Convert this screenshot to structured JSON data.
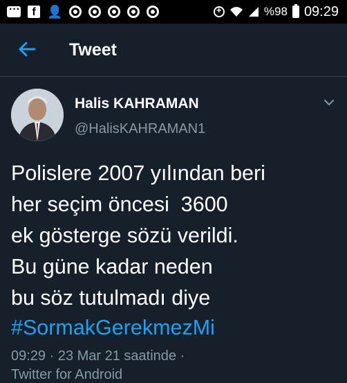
{
  "status_bar": {
    "battery_percent": "%98",
    "time": "09:29",
    "icons": [
      "message-icon",
      "facebook-icon",
      "add-user-icon",
      "chrome-icon",
      "chrome-icon",
      "chrome-icon",
      "chrome-icon",
      "chrome-icon",
      "sync-icon",
      "wifi-icon",
      "signal-icon",
      "battery-icon"
    ]
  },
  "app_bar": {
    "title": "Tweet",
    "back_icon": "arrow-left-icon"
  },
  "tweet": {
    "author_name": "Halis KAHRAMAN",
    "author_handle": "@HalisKAHRAMAN1",
    "text": "Polislere 2007 yılından beri\nher seçim öncesi  3600\nek gösterge sözü verildi.\nBu güne kadar neden\nbu söz tutulmadı diye",
    "hashtag": "#SormakGerekmezMi",
    "timestamp": "09:29 · 23 Mar 21 saatinde ·",
    "source": "Twitter for Android"
  },
  "colors": {
    "background": "#15202b",
    "accent": "#1da1f2",
    "muted_text": "#8899a6",
    "divider": "#38444d"
  }
}
